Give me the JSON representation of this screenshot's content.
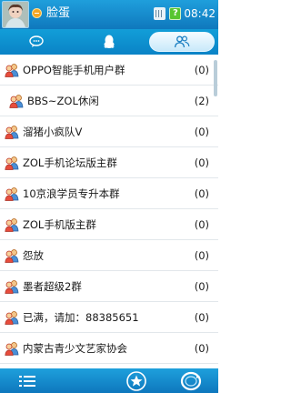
{
  "status_bar": {
    "nickname": "脸蛋",
    "time": "08:42",
    "battery_glyph": "?"
  },
  "tabs": [
    {
      "name": "chat",
      "icon": "chat-bubble-icon",
      "selected": false
    },
    {
      "name": "qq",
      "icon": "qq-penguin-icon",
      "selected": false
    },
    {
      "name": "groups",
      "icon": "group-people-icon",
      "selected": true
    }
  ],
  "group_list": [
    {
      "name": "OPPO智能手机用户群",
      "count": "(0)"
    },
    {
      "name": "BBS~ZOL休闲",
      "count": "(2)"
    },
    {
      "name": "溜猪小疯队V",
      "count": "(0)"
    },
    {
      "name": "ZOL手机论坛版主群",
      "count": "(0)"
    },
    {
      "name": "10京浪学员专升本群",
      "count": "(0)"
    },
    {
      "name": "ZOL手机版主群",
      "count": "(0)"
    },
    {
      "name": "怨放",
      "count": "(0)"
    },
    {
      "name": "墨者超级2群",
      "count": "(0)"
    },
    {
      "name": "已满，请加：88385651",
      "count": "(0)"
    },
    {
      "name": "内蒙古青少文艺家协会",
      "count": "(0)"
    }
  ],
  "bottom_bar": [
    {
      "name": "menu",
      "icon": "menu-list-icon"
    },
    {
      "name": "favorites",
      "icon": "star-icon"
    },
    {
      "name": "switch",
      "icon": "loop-icon"
    }
  ],
  "colors": {
    "bar_top": "#1f9fdc",
    "bar_bottom": "#0f78bd",
    "divider": "#e2e7eb",
    "status_dot": "#f5a623",
    "battery": "#58c530"
  }
}
